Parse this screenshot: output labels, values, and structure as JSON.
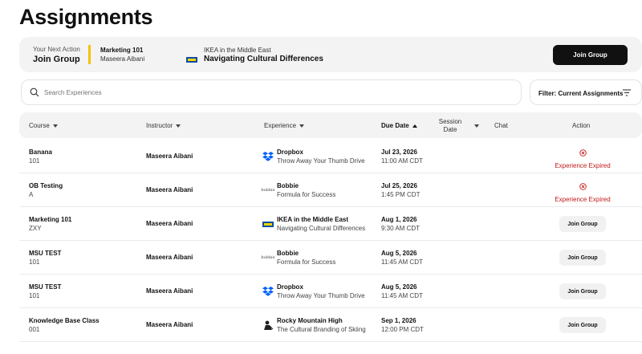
{
  "page": {
    "title": "Assignments"
  },
  "next_action": {
    "label": "Your Next Action",
    "value": "Join Group",
    "course": "Marketing 101",
    "instructor": "Maseera Aibani",
    "experience_subtitle": "IKEA in the Middle East",
    "experience_title": "Navigating Cultural Differences",
    "button_label": "Join Group",
    "accent_color": "#f5c400"
  },
  "search": {
    "placeholder": "Search Experiences"
  },
  "filter": {
    "label": "Filter: Current Assignments",
    "icon": "filter-lines-icon"
  },
  "table": {
    "headers": {
      "course": "Course",
      "instructor": "Instructor",
      "experience": "Experience",
      "due_date": "Due Date",
      "session_date": "Session Date",
      "chat": "Chat",
      "action": "Action"
    },
    "rows": [
      {
        "course": "Banana",
        "code": "101",
        "instructor": "Maseera Aibani",
        "logo": "dropbox-logo",
        "experience": "Dropbox",
        "experience_sub": "Throw Away Your Thumb Drive",
        "date": "Jul 23, 2026",
        "time": "11:00 AM CDT",
        "action": "Experience Expired",
        "action_type": "expired"
      },
      {
        "course": "OB Testing",
        "code": "A",
        "instructor": "Maseera Aibani",
        "logo": "bobbie-logo",
        "experience": "Bobbie",
        "experience_sub": "Formula for Success",
        "date": "Jul 25, 2026",
        "time": "1:45 PM CDT",
        "action": "Experience Expired",
        "action_type": "expired"
      },
      {
        "course": "Marketing 101",
        "code": "ZXY",
        "instructor": "Maseera Aibani",
        "logo": "ikea-logo",
        "experience": "IKEA in the Middle East",
        "experience_sub": "Navigating Cultural Differences",
        "date": "Aug 1, 2026",
        "time": "9:30 AM CDT",
        "action": "Join Group",
        "action_type": "button"
      },
      {
        "course": "MSU TEST",
        "code": "101",
        "instructor": "Maseera Aibani",
        "logo": "bobbie-logo",
        "experience": "Bobbie",
        "experience_sub": "Formula for Success",
        "date": "Aug 5, 2026",
        "time": "11:45 AM CDT",
        "action": "Join Group",
        "action_type": "button"
      },
      {
        "course": "MSU TEST",
        "code": "101",
        "instructor": "Maseera Aibani",
        "logo": "dropbox-logo",
        "experience": "Dropbox",
        "experience_sub": "Throw Away Your Thumb Drive",
        "date": "Aug 5, 2026",
        "time": "11:45 AM CDT",
        "action": "Join Group",
        "action_type": "button"
      },
      {
        "course": "Knowledge Base Class",
        "code": "001",
        "instructor": "Maseera Aibani",
        "logo": "rocky-mountain-logo",
        "experience": "Rocky Mountain High",
        "experience_sub": "The Cultural Branding of Skiing",
        "date": "Sep 1, 2026",
        "time": "12:00 PM CDT",
        "action": "Join Group",
        "action_type": "button"
      }
    ]
  },
  "colors": {
    "expired": "#c21a1a",
    "dropbox": "#0061fe",
    "ikea_blue": "#0b4ea2",
    "ikea_yellow": "#f5d300"
  }
}
